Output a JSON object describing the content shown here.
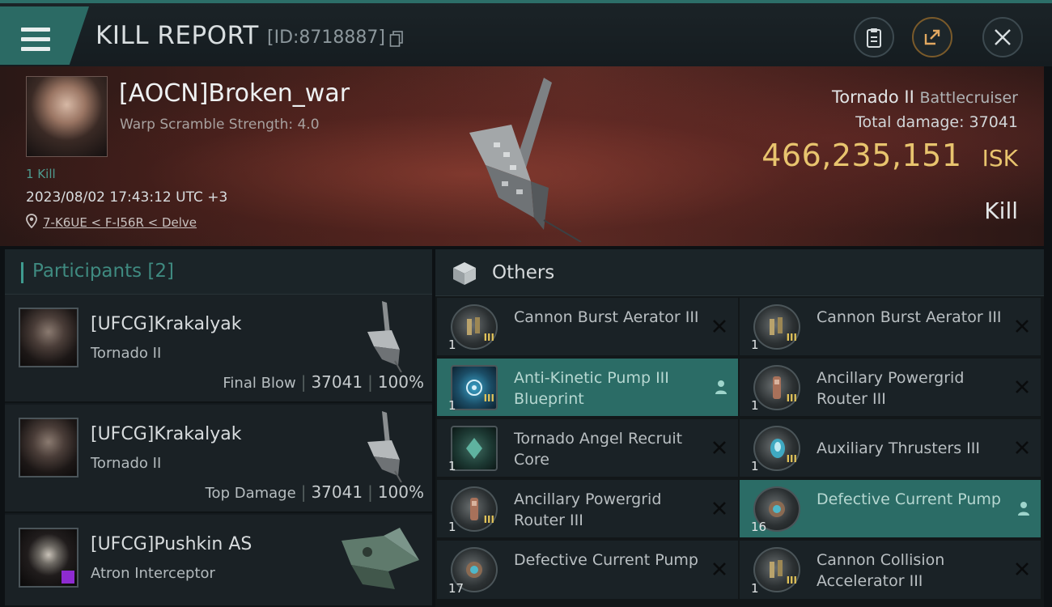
{
  "header": {
    "title": "KILL REPORT",
    "report_id": "[ID:8718887]"
  },
  "victim": {
    "name": "[AOCN]Broken_war",
    "warp_scramble": "Warp Scramble Strength: 4.0",
    "kills": "1 Kill",
    "datetime": "2023/08/02 17:43:12 UTC +3",
    "location": "7-K6UE < F-I56R < Delve",
    "ship_name": "Tornado II",
    "ship_class": "Battlecruiser",
    "total_damage_label": "Total damage:",
    "total_damage": "37041",
    "isk_value": "466,235,151",
    "isk_unit": "ISK",
    "result": "Kill"
  },
  "participants": {
    "title": "Participants",
    "count": "[2]",
    "rows": [
      {
        "name": "[UFCG]Krakalyak",
        "ship": "Tornado II",
        "tag": "Final Blow",
        "damage": "37041",
        "percent": "100%"
      },
      {
        "name": "[UFCG]Krakalyak",
        "ship": "Tornado II",
        "tag": "Top Damage",
        "damage": "37041",
        "percent": "100%"
      },
      {
        "name": "[UFCG]Pushkin AS",
        "ship": "Atron Interceptor"
      }
    ]
  },
  "others": {
    "title": "Others",
    "items": [
      {
        "name": "Cannon Burst Aerator III",
        "qty": "1",
        "tier": "III"
      },
      {
        "name": "Cannon Burst Aerator III",
        "qty": "1",
        "tier": "III"
      },
      {
        "name": "Anti-Kinetic Pump III Blueprint",
        "qty": "1",
        "tier": "III"
      },
      {
        "name": "Ancillary Powergrid Router III",
        "qty": "1",
        "tier": "III"
      },
      {
        "name": "Tornado Angel Recruit Core",
        "qty": "1"
      },
      {
        "name": "Auxiliary Thrusters III",
        "qty": "1",
        "tier": "III"
      },
      {
        "name": "Ancillary Powergrid Router III",
        "qty": "1",
        "tier": "III"
      },
      {
        "name": "Defective Current Pump",
        "qty": "16"
      },
      {
        "name": "Defective Current Pump",
        "qty": "17"
      },
      {
        "name": "Cannon Collision Accelerator III",
        "qty": "1",
        "tier": "III"
      }
    ]
  },
  "colors": {
    "accent": "#2b6c66",
    "isk": "#e8c46e",
    "participants_title": "#3f8a80"
  }
}
